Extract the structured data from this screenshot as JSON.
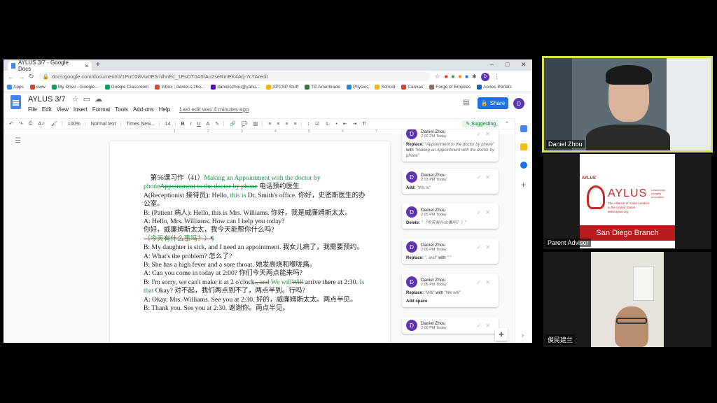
{
  "browser": {
    "tab_title": "AYLUS 3/7 - Google Docs",
    "new_tab": "+",
    "url": "docs.google.com/document/d/1PuD28Vw0E5mlhnEc_1EsOT0A5IAu2seRmEK4Aq-7c7A/edit",
    "profile": "D"
  },
  "bookmarks": [
    {
      "label": "Apps",
      "color": "#4285f4"
    },
    {
      "label": "eww",
      "color": "#db4437"
    },
    {
      "label": "My Drive - Google...",
      "color": "#0f9d58"
    },
    {
      "label": "Google Classroom",
      "color": "#0f9d58"
    },
    {
      "label": "Inbox - daniel.s.zho...",
      "color": "#ea4335"
    },
    {
      "label": "danielszhou@yaho...",
      "color": "#6001d2"
    },
    {
      "label": "APCSP Stuff",
      "color": "#f4b400"
    },
    {
      "label": "TD Ameritrade",
      "color": "#2e7d32"
    },
    {
      "label": "Physics",
      "color": "#1e88e5"
    },
    {
      "label": "School",
      "color": "#f4b400"
    },
    {
      "label": "Canvas",
      "color": "#e53935"
    },
    {
      "label": "Forge of Empires",
      "color": "#8d6e63"
    },
    {
      "label": "Aeries Portals",
      "color": "#1565c0"
    }
  ],
  "doc": {
    "title": "AYLUS 3/7",
    "menus": [
      "File",
      "Edit",
      "View",
      "Insert",
      "Format",
      "Tools",
      "Add-ons",
      "Help"
    ],
    "last_edit": "Last edit was 4 minutes ago",
    "share": "Share",
    "avatar": "D"
  },
  "toolbar": {
    "zoom": "100%",
    "style": "Normal text",
    "font": "Times New...",
    "size": "14",
    "mode": "Suggesting"
  },
  "content": {
    "title_a": "第56课习作（41）",
    "title_ins": "Making an Appointment with the doctor by phone",
    "title_del": "Appointment to the doctor by phone",
    "title_b": " 电话预约医生",
    "l1a": "A(Receptionist 接待员): Hello, ",
    "l1ins": "this is",
    "l1b": " Dr. Smith's office. 你好，史密斯医生的办公室。",
    "l2": "B: (Patient 病人): Hello, this is Mrs. Williams. 你好，我是威廉姆斯太太。",
    "l3": "A: Hello, Mrs. Williams.  How can I help you today?",
    "l4": "你好，威廉姆斯太太，我今天能帮你什么吗?",
    "l5del": "（今天有什么事吗？）¶",
    "l6": "B: My daughter is sick, and I need an appointment. 我女儿病了，我需要预约。",
    "l7": "A: What's the problem? 怎么了?",
    "l8": "B: She has a high fever and a sore throat. 她发高烧和喉咙痛。",
    "l9": "A: Can you come in today at 2:00? 你们今天两点能来吗?",
    "l10a": "B: I'm sorry, we can't make it at 2 o'clock",
    "l10del1": "., and",
    "l10ins1": " We will",
    "l10del2": "Will",
    "l10b": " arrive there at 2:30. ",
    "l10ins2": "Is that",
    "l10c": " Okay? 对不起，我们两点到不了，两点半到。行吗?",
    "l11": "A: Okay, Mrs. Williams. See you at 2:30. 好的，威廉姆斯太太。两点半见。",
    "l12": "B: Thank you. See you at 2:30. 谢谢你。两点半见。"
  },
  "comments": [
    {
      "name": "Daniel Zhou",
      "time": "2:02 PM Today",
      "action": "Replace:",
      "q1": "\"Appointment to the doctor by phone\"",
      "mid": " with ",
      "q2": "\"Making an Appointment with the doctor by phone\"",
      "extra": ""
    },
    {
      "name": "Daniel Zhou",
      "time": "2:03 PM Today",
      "action": "Add:",
      "q1": "\"this is\"",
      "mid": "",
      "q2": "",
      "extra": ""
    },
    {
      "name": "Daniel Zhou",
      "time": "2:05 PM Today",
      "action": "Delete:",
      "q1": "\"（今天有什么事吗？）\"",
      "mid": "",
      "q2": "",
      "extra": ""
    },
    {
      "name": "Daniel Zhou",
      "time": "2:06 PM Today",
      "action": "Replace:",
      "q1": "\", and\"",
      "mid": " with ",
      "q2": "\".\"",
      "extra": ""
    },
    {
      "name": "Daniel Zhou",
      "time": "2:06 PM Today",
      "action": "Replace:",
      "q1": "\"Will\"",
      "mid": " with ",
      "q2": "\"We will\"",
      "extra": "Add space"
    },
    {
      "name": "Daniel Zhou",
      "time": "2:06 PM Today",
      "action": "",
      "q1": "",
      "mid": "",
      "q2": "",
      "extra": ""
    }
  ],
  "videos": {
    "v1": "Daniel Zhou",
    "v2": "Parent Advisor",
    "v3": "俊民建兰",
    "logo_small": "AYLUS",
    "logo_big": "AYLUS",
    "logo_tag1": "Leadership",
    "logo_tag2": "Integrity",
    "logo_tag3": "Innovation",
    "logo_sub1": "The Alliance of Youth Leaders",
    "logo_sub2": "in the United States",
    "logo_url": "www.aylus.org",
    "branch": "San Diego Branch"
  }
}
